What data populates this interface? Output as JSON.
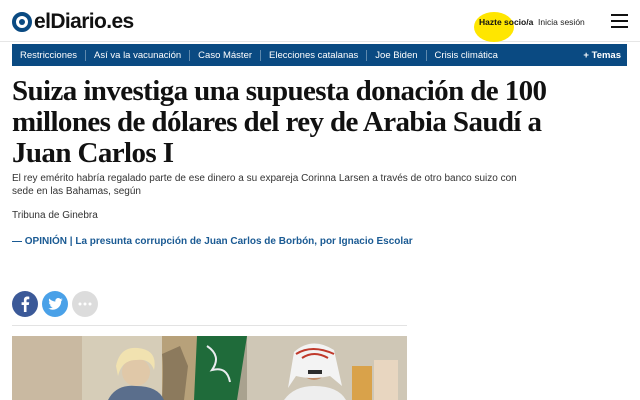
{
  "header": {
    "logo_text": "elDiario.es",
    "subscribe_label": "Hazte socio/a",
    "login_label": "Inicia sesión",
    "menu_icon": "hamburger-menu-icon"
  },
  "nav": {
    "items": [
      {
        "label": "Restricciones"
      },
      {
        "label": "Así va la vacunación"
      },
      {
        "label": "Caso Máster"
      },
      {
        "label": "Elecciones catalanas"
      },
      {
        "label": "Joe Biden"
      },
      {
        "label": "Crisis climática"
      }
    ],
    "more_label": "+ Temas"
  },
  "article": {
    "headline": "Suiza investiga una supuesta donación de 100 millones de dólares del rey de Arabia Saudí a Juan Carlos I",
    "summary": "El rey emérito habría regalado parte de ese dinero a su expareja Corinna Larsen a través de otro banco suizo con sede en las Bahamas, según",
    "source": "Tribuna de Ginebra",
    "related_prefix": "— ",
    "related_link": "OPINIÓN | La presunta corrupción de Juan Carlos de Borbón, por Ignacio Escolar"
  },
  "share": {
    "buttons": [
      {
        "icon": "facebook-icon",
        "color": "#3b5998"
      },
      {
        "icon": "twitter-icon",
        "color": "#4aa1e8"
      },
      {
        "icon": "more-options-icon",
        "color": "#dcdcdc"
      }
    ]
  },
  "colors": {
    "brand_blue": "#0a4a82",
    "link_blue": "#1a5a93",
    "subscribe_highlight": "#ffe600"
  }
}
